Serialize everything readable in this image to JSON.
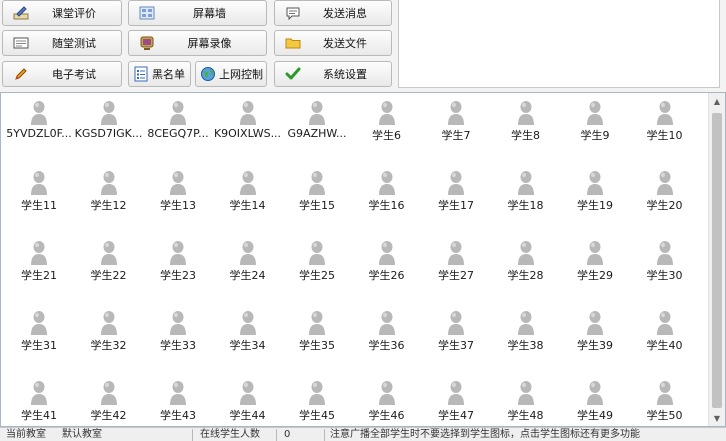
{
  "toolbar": {
    "buttons": [
      {
        "label": "课堂评价",
        "icon": "pen-board-icon"
      },
      {
        "label": "屏幕墙",
        "icon": "screen-wall-icon"
      },
      {
        "label": "发送消息",
        "icon": "message-bubble-icon"
      },
      {
        "label": "随堂测试",
        "icon": "test-paper-icon"
      },
      {
        "label": "屏幕录像",
        "icon": "screen-record-icon"
      },
      {
        "label": "发送文件",
        "icon": "folder-icon"
      },
      {
        "label": "电子考试",
        "icon": "pencil-icon"
      },
      {
        "label": "黑名单",
        "icon": "list-icon"
      },
      {
        "label": "上网控制",
        "icon": "globe-icon"
      },
      {
        "label": "系统设置",
        "icon": "checkmark-icon"
      }
    ]
  },
  "students": [
    "5YVDZL0F...",
    "KGSD7IGK...",
    "8CEGQ7P...",
    "K9OIXLWS...",
    "G9AZHW...",
    "学生6",
    "学生7",
    "学生8",
    "学生9",
    "学生10",
    "学生11",
    "学生12",
    "学生13",
    "学生14",
    "学生15",
    "学生16",
    "学生17",
    "学生18",
    "学生19",
    "学生20",
    "学生21",
    "学生22",
    "学生23",
    "学生24",
    "学生25",
    "学生26",
    "学生27",
    "学生28",
    "学生29",
    "学生30",
    "学生31",
    "学生32",
    "学生33",
    "学生34",
    "学生35",
    "学生36",
    "学生37",
    "学生38",
    "学生39",
    "学生40",
    "学生41",
    "学生42",
    "学生43",
    "学生44",
    "学生45",
    "学生46",
    "学生47",
    "学生48",
    "学生49",
    "学生50"
  ],
  "statusbar": {
    "classroom_label": "当前教室",
    "classroom_value": "默认教室",
    "online_label": "在线学生人数",
    "online_count": "0",
    "tip": "注意广播全部学生时不要选择到学生图标，点击学生图标还有更多功能"
  },
  "colors": {
    "student_icon": "#b8b8b8",
    "panel_border": "#a9b4c4",
    "scrollbar_thumb": "#c2c2c2"
  }
}
